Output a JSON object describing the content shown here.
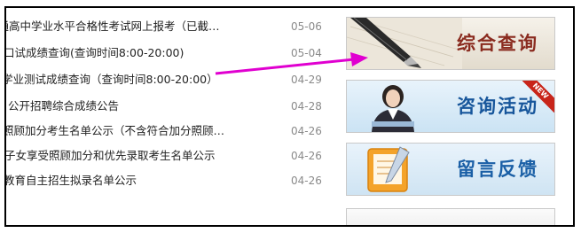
{
  "news": {
    "items": [
      {
        "title": "普通高中学业水平合格性考试网上报考（已截…",
        "date": "05-06"
      },
      {
        "title": "口试成绩查询(查询时间8:00-20:00)",
        "date": "05-04"
      },
      {
        "title": "学业测试成绩查询（查询时间8:00-20:00）",
        "date": "04-29"
      },
      {
        "title": "公开招聘综合成绩公告",
        "date": "04-28"
      },
      {
        "title": "照顾加分考生名单公示（不含符合加分照顾…",
        "date": "04-26"
      },
      {
        "title": "子女享受照顾加分和优先录取考生名单公示",
        "date": "04-26"
      },
      {
        "title": "教育自主招生拟录名单公示",
        "date": "04-26"
      }
    ]
  },
  "banners": {
    "query": {
      "label": "综合查询"
    },
    "consult": {
      "label": "咨询活动",
      "badge": "NEW"
    },
    "message": {
      "label": "留言反馈"
    }
  },
  "colors": {
    "arrow": "#e000d0",
    "date": "#8a8a8a"
  }
}
